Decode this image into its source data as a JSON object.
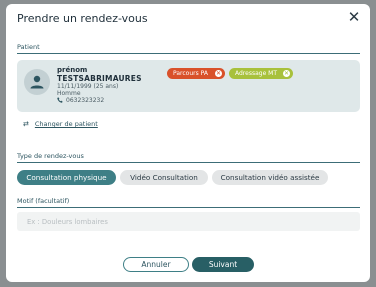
{
  "modal": {
    "title": "Prendre un rendez-vous",
    "close_icon": "close-icon"
  },
  "patient_section": {
    "label": "Patient",
    "firstname": "prénom",
    "lastname": "TESTSABRIMAURES",
    "dob": "11/11/1999 (25 ans)",
    "sex": "Homme",
    "phone": "0632323232",
    "badges": [
      {
        "label": "Parcours PA",
        "color": "#d9512a"
      },
      {
        "label": "Adressage MT",
        "color": "#a8c13c"
      }
    ],
    "change_link": "Changer de patient"
  },
  "type_section": {
    "label": "Type de rendez-vous",
    "options": [
      {
        "label": "Consultation physique",
        "selected": true
      },
      {
        "label": "Vidéo Consultation",
        "selected": false
      },
      {
        "label": "Consultation vidéo assistée",
        "selected": false
      }
    ]
  },
  "motif_section": {
    "label": "Motif (facultatif)",
    "value": "",
    "placeholder": "Ex : Douleurs lombaires"
  },
  "actions": {
    "cancel": "Annuler",
    "submit": "Suivant"
  },
  "colors": {
    "accent": "#3e7f86",
    "primary_dark": "#285f65",
    "card_bg": "#dfe8e9"
  }
}
